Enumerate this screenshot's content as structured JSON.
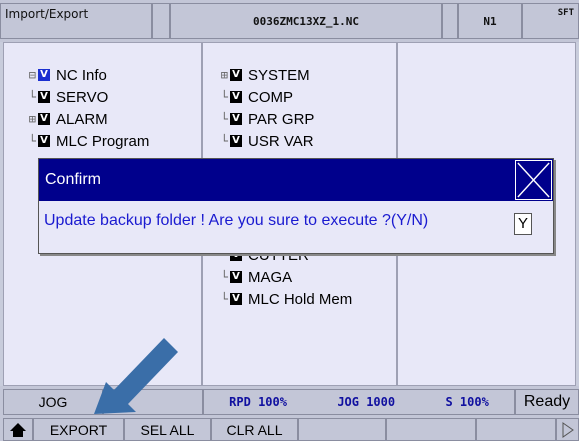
{
  "titlebar": {
    "title": "Import/Export",
    "file": "0036ZMC13XZ_1.NC",
    "channel": "N1",
    "shift": "SFT"
  },
  "left_tree": [
    {
      "label": "NC Info",
      "checked": "V",
      "expander": "⊟"
    },
    {
      "label": "SERVO",
      "checked": "V"
    },
    {
      "label": "ALARM",
      "checked": "V",
      "expander": "⊞"
    },
    {
      "label": "MLC Program",
      "checked": "V"
    }
  ],
  "right_tree_top": [
    {
      "label": "SYSTEM",
      "checked": "V",
      "expander": "⊞"
    },
    {
      "label": "COMP",
      "checked": "V"
    },
    {
      "label": "PAR GRP",
      "checked": "V"
    },
    {
      "label": "USR VAR",
      "checked": "V"
    }
  ],
  "right_tree_bottom": [
    {
      "label": "CUTTER",
      "checked": "V"
    },
    {
      "label": "MAGA",
      "checked": "V"
    },
    {
      "label": "MLC Hold Mem",
      "checked": "V"
    }
  ],
  "dialog": {
    "title": "Confirm",
    "message": "Update backup folder !  Are you sure to execute ?(Y/N)",
    "input_value": "Y"
  },
  "status": {
    "mode": "JOG",
    "rapid": "RPD 100%",
    "jog": "JOG 1000",
    "spindle": "S 100%",
    "state": "Ready"
  },
  "softkeys": {
    "export": "EXPORT",
    "sel_all": "SEL ALL",
    "clr_all": "CLR ALL"
  },
  "colors": {
    "dialog_header": "#00008c",
    "message_text": "#1a1ad0",
    "arrow": "#3a6ea8"
  }
}
